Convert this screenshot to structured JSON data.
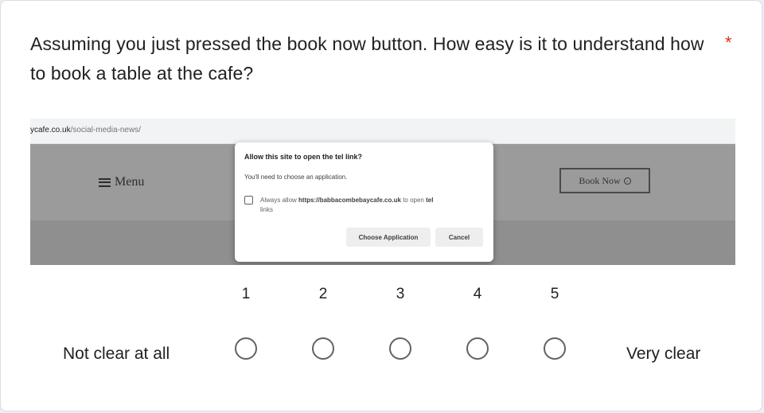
{
  "question": {
    "text": "Assuming you just pressed the book now button. How easy is it to understand how to book a table at the cafe?",
    "required_marker": "*"
  },
  "screenshot": {
    "url_domain": "ycafe.co.uk",
    "url_path": "/social-media-news/",
    "menu_label": "Menu",
    "book_now_label": "Book Now",
    "dialog": {
      "title": "Allow this site to open the tel link?",
      "subtitle": "You'll need to choose an application.",
      "allow_prefix": "Always allow",
      "allow_site": "https://babbacombebaycafe.co.uk",
      "allow_middle": "to open",
      "allow_scheme": "tel",
      "allow_suffix": "links",
      "choose_label": "Choose Application",
      "cancel_label": "Cancel"
    }
  },
  "scale": {
    "low_label": "Not clear at all",
    "high_label": "Very clear",
    "options": [
      "1",
      "2",
      "3",
      "4",
      "5"
    ],
    "selected": null
  },
  "colors": {
    "required": "#d93025",
    "radio_border": "#5f6368",
    "page_background": "#f0ebf8"
  }
}
